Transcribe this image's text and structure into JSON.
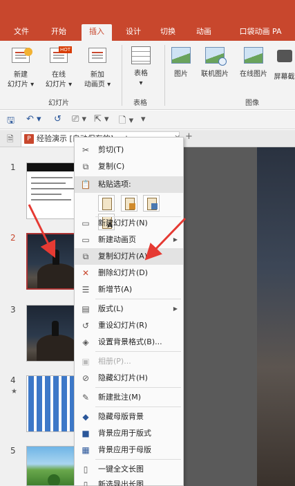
{
  "ribbon_tabs": [
    {
      "label": "文件"
    },
    {
      "label": "开始"
    },
    {
      "label": "插入",
      "active": true
    },
    {
      "label": "设计"
    },
    {
      "label": "切换"
    },
    {
      "label": "动画"
    },
    {
      "label": "口袋动画 PA"
    }
  ],
  "ribbon": {
    "new_slide": "新建\n幻灯片 ▾",
    "online_slide": "在线\n幻灯片 ▾",
    "new_anim_page": "新加\n动画页 ▾",
    "hot_badge": "HOT",
    "table": "表格\n▾",
    "picture": "图片",
    "linked_picture": "联机图片",
    "online_picture": "在线图片",
    "screenshot": "屏幕截",
    "group_slides": "幻灯片",
    "group_tables": "表格",
    "group_images": "图像"
  },
  "quick_access": {
    "save": "🖫",
    "undo": "↶ ▾",
    "redo": "↺",
    "start_icon": "⎚ ▾",
    "touch": "⇱ ▾",
    "new_doc": "🗋 ▾",
    "more": "▾"
  },
  "document_tab": {
    "label": "经验演示 [自动保存的].pptx",
    "close": "×",
    "add": "+"
  },
  "slides": [
    {
      "number": "1"
    },
    {
      "number": "2",
      "selected": true
    },
    {
      "number": "3"
    },
    {
      "number": "4",
      "star": "★"
    },
    {
      "number": "5"
    }
  ],
  "context_menu": {
    "cut": "剪切(T)",
    "copy": "复制(C)",
    "paste_options": "粘贴选项:",
    "new_slide": "新建幻灯片(N)",
    "new_anim_page": "新建动画页",
    "duplicate_slide": "复制幻灯片(A)",
    "delete_slide": "删除幻灯片(D)",
    "new_section": "新增节(A)",
    "layout": "版式(L)",
    "reset_slide": "重设幻灯片(R)",
    "format_background": "设置背景格式(B)...",
    "photo_album": "相册(P)...",
    "hide_slide": "隐藏幻灯片(H)",
    "new_comment": "新建批注(M)",
    "hide_master_bg": "隐藏母版背景",
    "apply_bg_layout": "背景应用于版式",
    "apply_bg_master": "背景应用于母版",
    "one_click_long_image": "一键全文长图",
    "export_long_image": "新选导出长图"
  },
  "annotations": {
    "arrow_color": "#e53a33"
  },
  "colors": {
    "accent": "#c8472d",
    "menu_highlight": "#e3e3e3"
  }
}
